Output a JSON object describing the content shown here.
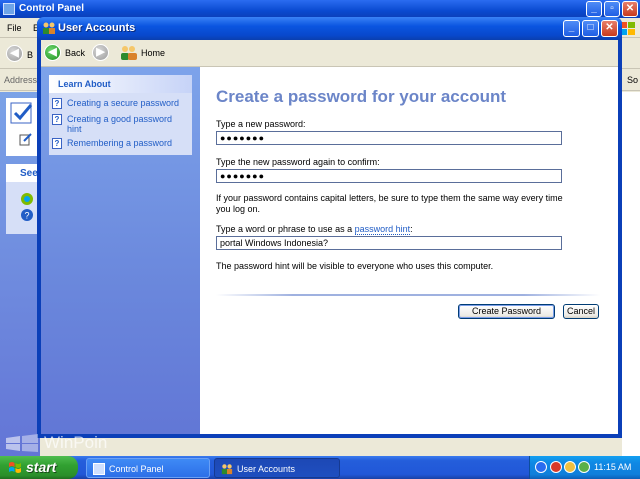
{
  "background_window": {
    "title": "Control Panel",
    "menu": [
      "File",
      "E"
    ],
    "toolbar_partial": "B",
    "address_label": "Address",
    "go_partial": "So",
    "see_also_partial": "See"
  },
  "window": {
    "title": "User Accounts",
    "nav": {
      "back_label": "Back",
      "home_label": "Home"
    }
  },
  "sidebar": {
    "learn_about_title": "Learn About",
    "items": [
      {
        "label": "Creating a secure password"
      },
      {
        "label": "Creating a good password hint"
      },
      {
        "label": "Remembering a password"
      }
    ]
  },
  "form": {
    "heading": "Create a password for your account",
    "new_password_label": "Type a new password:",
    "new_password_value": "●●●●●●●",
    "confirm_label": "Type the new password again to confirm:",
    "confirm_value": "●●●●●●●",
    "caps_note": "If your password contains capital letters, be sure to type them the same way every time you log on.",
    "hint_label_prefix": "Type a word or phrase to use as a",
    "hint_link": "password hint",
    "hint_label_suffix": ":",
    "hint_value": "portal Windows Indonesia?",
    "hint_note": "The password hint will be visible to everyone who uses this computer.",
    "create_button": "Create Password",
    "cancel_button": "Cancel"
  },
  "watermark": {
    "text": "WinPoin"
  },
  "taskbar": {
    "start_label": "start",
    "tasks": [
      {
        "label": "Control Panel",
        "active": false
      },
      {
        "label": "User Accounts",
        "active": true
      }
    ],
    "clock": "11:15 AM"
  },
  "colors": {
    "title_bar": "#0a55e0",
    "link": "#215dc6",
    "heading": "#6b85c8",
    "sidebar_gradient_top": "#7da3ea",
    "start_green": "#31a131"
  }
}
